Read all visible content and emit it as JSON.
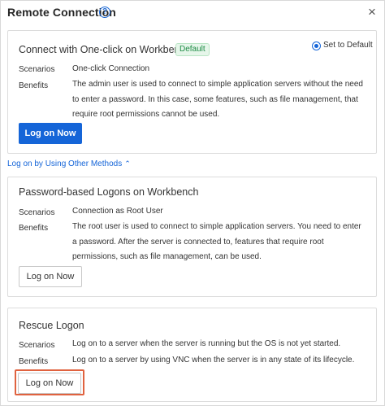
{
  "header": {
    "title": "Remote Connection",
    "help_icon": "question-circle-icon",
    "close_icon": "close-icon"
  },
  "workbench": {
    "title": "Connect with One-click on Workbench",
    "badge": "Default",
    "default_radio_label": "Set to Default",
    "default_selected": true,
    "scenarios_label": "Scenarios",
    "scenarios_value": "One-click Connection",
    "benefits_label": "Benefits",
    "benefits_value": "The admin user is used to connect to simple application servers without the need to enter a password. In this case, some features, such as file management, that require root permissions cannot be used.",
    "button_label": "Log on Now"
  },
  "other_methods": {
    "toggle_label": "Log on by Using Other Methods",
    "expanded": true
  },
  "password": {
    "title": "Password-based Logons on Workbench",
    "scenarios_label": "Scenarios",
    "scenarios_value": "Connection as Root User",
    "benefits_label": "Benefits",
    "benefits_value": "The root user is used to connect to simple application servers. You need to enter a password. After the server is connected to, features that require root permissions, such as file management, can be used.",
    "button_label": "Log on Now"
  },
  "rescue": {
    "title": "Rescue Logon",
    "scenarios_label": "Scenarios",
    "scenarios_value": "Log on to a server when the server is running but the OS is not yet started.",
    "benefits_label": "Benefits",
    "benefits_value": "Log on to a server by using VNC when the server is in any state of its lifecycle.",
    "button_label": "Log on Now"
  },
  "colors": {
    "primary": "#1565d8",
    "highlight": "#e0623f",
    "badge_text": "#1e8b45",
    "badge_bg": "#e6f6ea"
  }
}
